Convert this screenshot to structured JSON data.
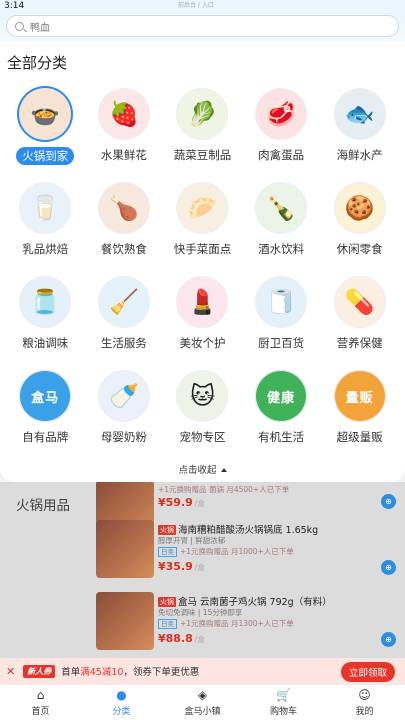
{
  "status": {
    "time": "3:14",
    "center": "前后台 / 入口"
  },
  "search": {
    "value": "鸭血"
  },
  "panel": {
    "title": "全部分类",
    "categories": [
      {
        "label": "火锅到家",
        "icon": "hotpot-icon",
        "glyph": "🍲",
        "bg": "#f7e3d4",
        "active": true
      },
      {
        "label": "水果鲜花",
        "icon": "strawberry-icon",
        "glyph": "🍓",
        "bg": "#fbe7e7"
      },
      {
        "label": "蔬菜豆制品",
        "icon": "vegetable-icon",
        "glyph": "🥬",
        "bg": "#eef5e4"
      },
      {
        "label": "肉禽蛋品",
        "icon": "meat-icon",
        "glyph": "🥩",
        "bg": "#fbe3e3"
      },
      {
        "label": "海鲜水产",
        "icon": "fish-icon",
        "glyph": "🐟",
        "bg": "#e6eef3"
      },
      {
        "label": "乳品烘焙",
        "icon": "milk-icon",
        "glyph": "🥛",
        "bg": "#e9f1fb"
      },
      {
        "label": "餐饮熟食",
        "icon": "cooked-food-icon",
        "glyph": "🍗",
        "bg": "#f6e8dc"
      },
      {
        "label": "快手菜面点",
        "icon": "dumpling-icon",
        "glyph": "🥟",
        "bg": "#f6efe2"
      },
      {
        "label": "酒水饮料",
        "icon": "drink-icon",
        "glyph": "🍾",
        "bg": "#eaf4e7"
      },
      {
        "label": "休闲零食",
        "icon": "snack-icon",
        "glyph": "🍪",
        "bg": "#fcf3d6"
      },
      {
        "label": "粮油调味",
        "icon": "oil-icon",
        "glyph": "🫙",
        "bg": "#e6f0fa"
      },
      {
        "label": "生活服务",
        "icon": "cleaner-icon",
        "glyph": "🧹",
        "bg": "#e3f2fb"
      },
      {
        "label": "美妆个护",
        "icon": "cosmetic-icon",
        "glyph": "💄",
        "bg": "#fbe6ee"
      },
      {
        "label": "厨卫百货",
        "icon": "tissue-icon",
        "glyph": "🧻",
        "bg": "#e4f1fb"
      },
      {
        "label": "营养保健",
        "icon": "supplement-icon",
        "glyph": "💊",
        "bg": "#fbefe3"
      },
      {
        "label": "自有品牌",
        "icon": "hema-brand-icon",
        "text": "盒马",
        "bg": "#3aa0e8"
      },
      {
        "label": "母婴奶粉",
        "icon": "formula-icon",
        "glyph": "🍼",
        "bg": "#eaf1fb"
      },
      {
        "label": "宠物专区",
        "icon": "cat-icon",
        "glyph": "🐱",
        "bg": "#eef3e8"
      },
      {
        "label": "有机生活",
        "icon": "organic-icon",
        "text": "健康",
        "bg": "#3fb25a"
      },
      {
        "label": "超级量贩",
        "icon": "bulk-icon",
        "text": "量贩",
        "bg": "#f2a43a"
      }
    ],
    "collapse_label": "点击收起"
  },
  "underlay": {
    "section": "火锅用品",
    "products": [
      {
        "name": "",
        "sub": "",
        "promo": "+1元换购赠品  菌锅 月4500+人已下单",
        "price": "¥59.9",
        "unit": "/盒"
      },
      {
        "name": "海南糟粕醋酸汤火锅锅底 1.65kg",
        "tag": "火锅",
        "sub": "醇厚开胃  |  鲜甜浓郁",
        "promo_box": "日卖",
        "promo": "+1元换购赠品  月1000+人已下单",
        "price": "¥35.9",
        "unit": "/盒"
      },
      {
        "name": "盒马 云南菌子鸡火锅 792g（有料）",
        "tag": "火锅",
        "sub": "免切免调味  |  15分钟即享",
        "promo_box": "日卖",
        "promo": "+1元换购赠品  月1300+人已下单",
        "price": "¥88.8",
        "unit": "/盒"
      }
    ]
  },
  "promo_strip": {
    "tag": "新人券",
    "text_prefix": "首单",
    "highlight": "满45减10",
    "text_suffix": "，领券下单更优惠",
    "claim": "立即领取"
  },
  "tabbar": [
    {
      "label": "首页",
      "icon": "home-icon",
      "glyph": "⌂"
    },
    {
      "label": "分类",
      "icon": "category-icon",
      "glyph": "●",
      "active": true
    },
    {
      "label": "盒马小镇",
      "icon": "town-icon",
      "glyph": "◈"
    },
    {
      "label": "购物车",
      "icon": "cart-icon",
      "glyph": "🛒"
    },
    {
      "label": "我的",
      "icon": "profile-icon",
      "glyph": "☺"
    }
  ]
}
